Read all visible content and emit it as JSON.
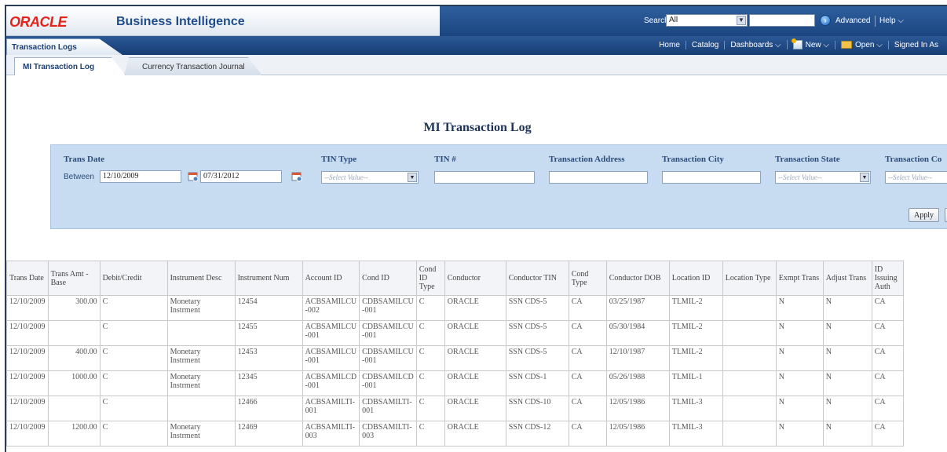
{
  "header": {
    "logo": "ORACLE",
    "app_title": "Business Intelligence",
    "search_label": "Search",
    "search_scope": "All",
    "advanced": "Advanced",
    "help": "Help ⌵"
  },
  "nav": {
    "dashboard_tab": "Transaction Logs",
    "home": "Home",
    "catalog": "Catalog",
    "dashboards": "Dashboards ⌵",
    "new": "New ⌵",
    "open": "Open ⌵",
    "signed_in": "Signed In As"
  },
  "subtabs": {
    "active": "MI Transaction Log",
    "inactive": "Currency Transaction Journal"
  },
  "page_title": "MI Transaction Log",
  "prompts": {
    "trans_date": {
      "label": "Trans Date",
      "between": "Between",
      "from": "12/10/2009",
      "to": "07/31/2012"
    },
    "tin_type": {
      "label": "TIN Type",
      "placeholder": "--Select Value--"
    },
    "tin_no": {
      "label": "TIN #",
      "value": ""
    },
    "address": {
      "label": "Transaction Address",
      "value": ""
    },
    "city": {
      "label": "Transaction City",
      "value": ""
    },
    "state": {
      "label": "Transaction State",
      "placeholder": "--Select Value--"
    },
    "country": {
      "label": "Transaction Co",
      "placeholder": "--Select Value--"
    },
    "apply": "Apply"
  },
  "table": {
    "columns": [
      "Trans Date",
      "Trans Amt - Base",
      "Debit/Credit",
      "Instrument Desc",
      "Instrument Num",
      "Account ID",
      "Cond ID",
      "Cond ID Type",
      "Conductor",
      "Conductor TIN",
      "Cond Type",
      "Conductor DOB",
      "Location ID",
      "Location Type",
      "Exmpt Trans",
      "Adjust Trans",
      "ID Issuing Auth"
    ],
    "rows": [
      [
        "12/10/2009",
        "300.00",
        "C",
        "Monetary Instrment",
        "12454",
        "ACBSAMILCU -002",
        "CDBSAMILCU -001",
        "C",
        "ORACLE",
        "SSN CDS-5",
        "CA",
        "03/25/1987",
        "TLMIL-2",
        "",
        "N",
        "N",
        "CA"
      ],
      [
        "12/10/2009",
        "",
        "C",
        "",
        "12455",
        "ACBSAMILCU -001",
        "CDBSAMILCU -001",
        "C",
        "ORACLE",
        "SSN CDS-5",
        "CA",
        "05/30/1984",
        "TLMIL-2",
        "",
        "N",
        "N",
        "CA"
      ],
      [
        "12/10/2009",
        "400.00",
        "C",
        "Monetary Instrment",
        "12453",
        "ACBSAMILCU -001",
        "CDBSAMILCU -001",
        "C",
        "ORACLE",
        "SSN CDS-5",
        "CA",
        "12/10/1987",
        "TLMIL-2",
        "",
        "N",
        "N",
        "CA"
      ],
      [
        "12/10/2009",
        "1000.00",
        "C",
        "Monetary Instrment",
        "12345",
        "ACBSAMILCD -001",
        "CDBSAMILCD -001",
        "C",
        "ORACLE",
        "SSN CDS-1",
        "CA",
        "05/26/1988",
        "TLMIL-1",
        "",
        "N",
        "N",
        "CA"
      ],
      [
        "12/10/2009",
        "",
        "C",
        "",
        "12466",
        "ACBSAMILTI- 001",
        "CDBSAMILTI- 001",
        "C",
        "ORACLE",
        "SSN CDS-10",
        "CA",
        "12/05/1986",
        "TLMIL-3",
        "",
        "N",
        "N",
        "CA"
      ],
      [
        "12/10/2009",
        "1200.00",
        "C",
        "Monetary Instrment",
        "12469",
        "ACBSAMILTI- 003",
        "CDBSAMILTI- 003",
        "C",
        "ORACLE",
        "SSN CDS-12",
        "CA",
        "12/05/1986",
        "TLMIL-3",
        "",
        "N",
        "N",
        "CA"
      ]
    ]
  }
}
